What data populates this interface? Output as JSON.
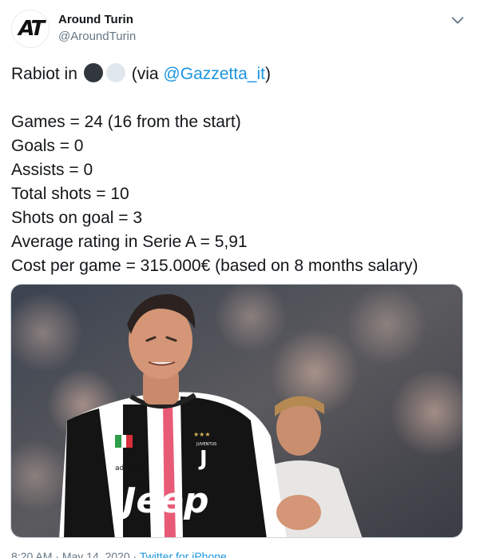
{
  "author": {
    "display_name": "Around Turin",
    "handle": "@AroundTurin",
    "avatar_text": "AT"
  },
  "tweet": {
    "intro_prefix": "Rabiot in",
    "via_open": "(via ",
    "via_mention": "@Gazzetta_it",
    "via_close": ")",
    "stats": [
      "Games = 24 (16 from the start)",
      "Goals = 0",
      "Assists = 0",
      "Total shots = 10",
      "Shots on goal = 3",
      "Average rating in Serie A = 5,91",
      "Cost per game = 315.000€ (based on 8 months salary)"
    ],
    "jersey_sponsor": "Jeep",
    "jersey_brand": "adidas",
    "crest_text": "JUVENTUS"
  },
  "meta": {
    "time": "8:20 AM",
    "sep": " · ",
    "date": "May 14, 2020",
    "source": "Twitter for iPhone"
  },
  "colors": {
    "link": "#1b95e0",
    "secondary_text": "#657786",
    "primary_text": "#14171a",
    "emoji_black": "#31373d",
    "emoji_white": "#e1e8ed"
  },
  "icons": {
    "caret": "chevron-down-icon",
    "emoji_1": "black-circle-icon",
    "emoji_2": "white-circle-icon"
  }
}
